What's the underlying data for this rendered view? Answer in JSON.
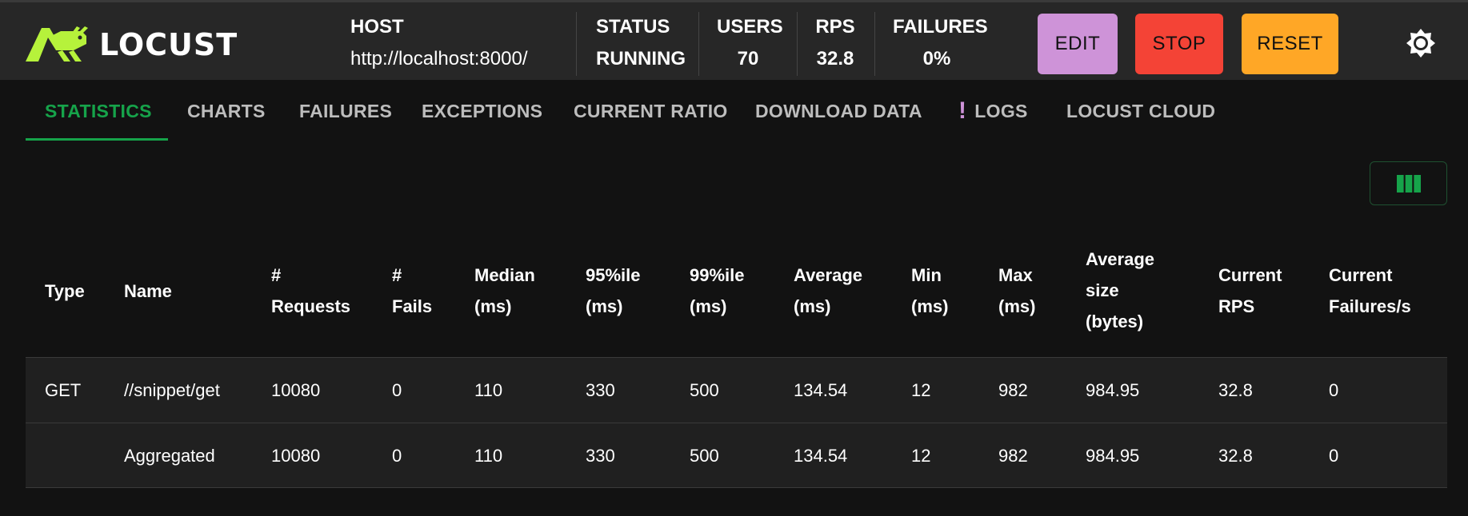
{
  "app": {
    "logo_text": "LOCUST"
  },
  "header": {
    "host": {
      "label": "HOST",
      "value": "http://localhost:8000/"
    },
    "status": {
      "label": "STATUS",
      "value": "RUNNING"
    },
    "users": {
      "label": "USERS",
      "value": "70"
    },
    "rps": {
      "label": "RPS",
      "value": "32.8"
    },
    "failures": {
      "label": "FAILURES",
      "value": "0%"
    },
    "buttons": {
      "edit": {
        "label": "EDIT",
        "color": "#ce93d8"
      },
      "stop": {
        "label": "STOP",
        "color": "#f44336"
      },
      "reset": {
        "label": "RESET",
        "color": "#ffa726"
      }
    },
    "theme_icon": "brightness-icon"
  },
  "tabs": [
    {
      "label": "STATISTICS",
      "active": true
    },
    {
      "label": "CHARTS"
    },
    {
      "label": "FAILURES"
    },
    {
      "label": "EXCEPTIONS"
    },
    {
      "label": "CURRENT RATIO"
    },
    {
      "label": "DOWNLOAD DATA"
    },
    {
      "label": "LOGS",
      "alert_icon": "!"
    },
    {
      "label": "LOCUST CLOUD"
    }
  ],
  "table": {
    "columns_toggle_icon": "view-column-icon",
    "headers": [
      [
        "Type"
      ],
      [
        "Name"
      ],
      [
        "#",
        "Requests"
      ],
      [
        "#",
        "Fails"
      ],
      [
        "Median",
        "(ms)"
      ],
      [
        "95%ile",
        "(ms)"
      ],
      [
        "99%ile",
        "(ms)"
      ],
      [
        "Average",
        "(ms)"
      ],
      [
        "Min",
        "(ms)"
      ],
      [
        "Max",
        "(ms)"
      ],
      [
        "Average",
        "size",
        "(bytes)"
      ],
      [
        "Current",
        "RPS"
      ],
      [
        "Current",
        "Failures/s"
      ]
    ],
    "rows": [
      [
        "GET",
        "//snippet/get",
        "10080",
        "0",
        "110",
        "330",
        "500",
        "134.54",
        "12",
        "982",
        "984.95",
        "32.8",
        "0"
      ],
      [
        "",
        "Aggregated",
        "10080",
        "0",
        "110",
        "330",
        "500",
        "134.54",
        "12",
        "982",
        "984.95",
        "32.8",
        "0"
      ]
    ]
  },
  "colors": {
    "accent": "#16a34a",
    "background": "#121212",
    "header_background": "#272727",
    "row_background": "#202020"
  }
}
